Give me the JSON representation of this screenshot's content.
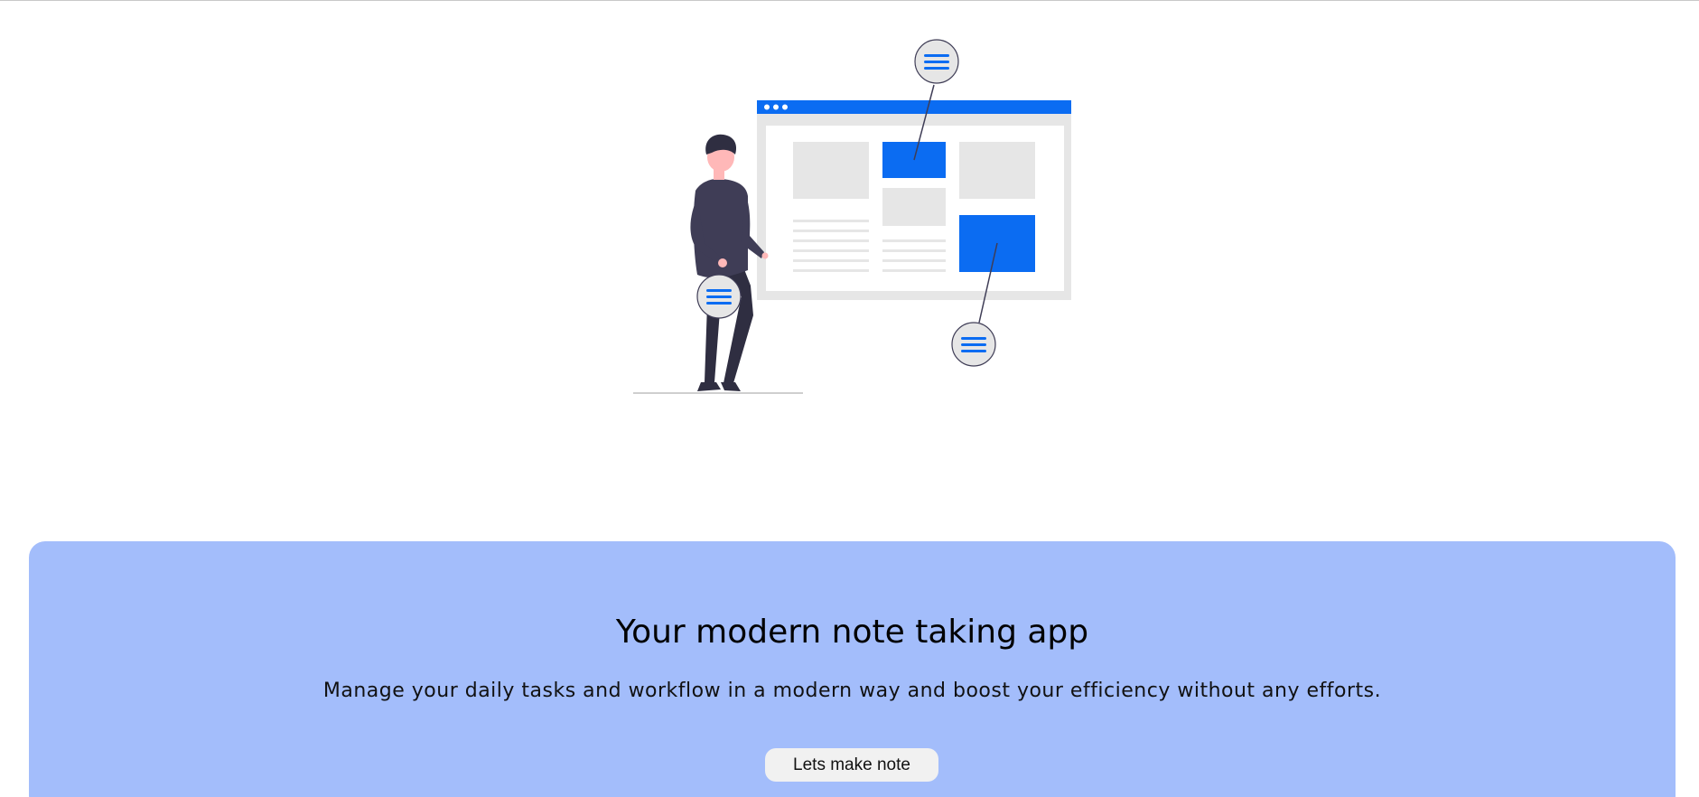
{
  "colors": {
    "accent": "#0b6cf2",
    "panel_background": "#a3bdfb",
    "button_background": "#f1f1f1",
    "figure_dark": "#3f3d56",
    "figure_skin": "#ffb8b8",
    "screen_gray": "#e6e6e6"
  },
  "hero": {
    "illustration_icon": "person-with-browser-window-illustration"
  },
  "cta": {
    "title": "Your modern note taking app",
    "subtitle": "Manage your daily tasks and workflow in a modern way and boost your efficiency without any efforts.",
    "button_label": "Lets make note"
  }
}
